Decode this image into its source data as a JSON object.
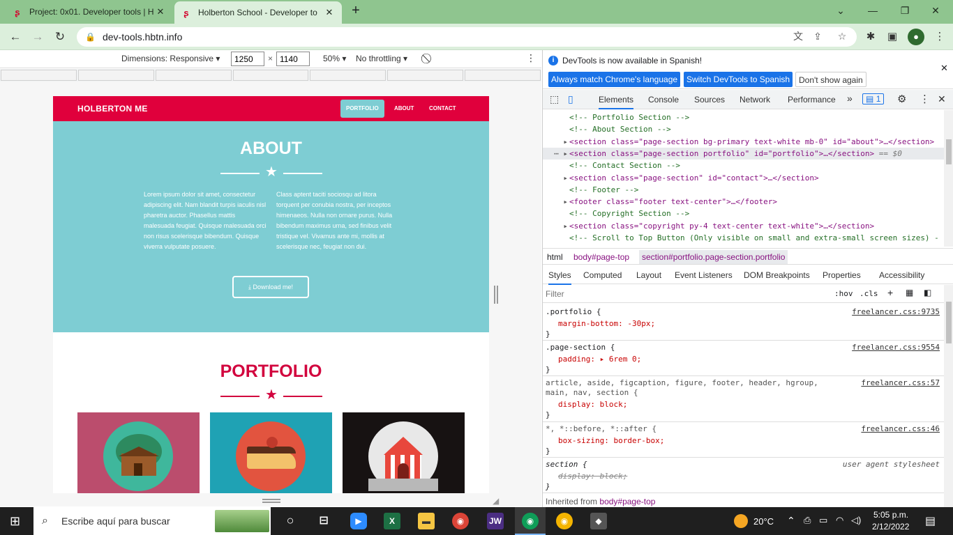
{
  "browser": {
    "tabs": [
      {
        "title": "Project: 0x01. Developer tools | H",
        "active": false
      },
      {
        "title": "Holberton School - Developer to",
        "active": true
      }
    ],
    "url": "dev-tools.hbtn.info"
  },
  "device_toolbar": {
    "dimensions_label": "Dimensions: Responsive",
    "width": "1250",
    "height": "1140",
    "times": "×",
    "zoom": "50%",
    "throttling": "No throttling"
  },
  "site": {
    "brand": "HOLBERTON ME",
    "nav": [
      "PORTFOLIO",
      "ABOUT",
      "CONTACT"
    ],
    "about_title": "ABOUT",
    "about_left": "Lorem ipsum dolor sit amet, consectetur adipiscing elit. Nam blandit turpis iaculis nisl pharetra auctor. Phasellus mattis malesuada feugiat. Quisque malesuada orci non risus scelerisque bibendum. Quisque viverra vulputate posuere.",
    "about_right": "Class aptent taciti sociosqu ad litora torquent per conubia nostra, per inceptos himenaeos. Nulla non ornare purus. Nulla bibendum maximus urna, sed finibus velit tristique vel. Vivamus ante mi, mollis at scelerisque nec, feugiat non dui.",
    "download_label": "Download me!",
    "portfolio_title": "PORTFOLIO",
    "colors": {
      "primary": "#e0003c",
      "about_bg": "#7ecdd3",
      "portfolio": "#d2043e"
    }
  },
  "devtools": {
    "info_message": "DevTools is now available in Spanish!",
    "btn_match": "Always match Chrome's language",
    "btn_switch": "Switch DevTools to Spanish",
    "btn_dont_show": "Don't show again",
    "tabs": [
      "Elements",
      "Console",
      "Sources",
      "Network",
      "Performance"
    ],
    "more": "»",
    "issues_count": "1",
    "dom_lines": [
      {
        "type": "comment",
        "text": "<!-- Portfolio Section -->"
      },
      {
        "type": "comment",
        "text": "<!-- About Section -->"
      },
      {
        "type": "tag",
        "text": "<section class=\"page-section bg-primary text-white mb-0\" id=\"about\">…</section>"
      },
      {
        "type": "tag",
        "text": "<section class=\"page-section portfolio\" id=\"portfolio\">…</section>",
        "selected": true,
        "suffix": "== $0"
      },
      {
        "type": "comment",
        "text": "<!-- Contact Section -->"
      },
      {
        "type": "tag",
        "text": "<section class=\"page-section\" id=\"contact\">…</section>"
      },
      {
        "type": "comment",
        "text": "<!-- Footer -->"
      },
      {
        "type": "tag",
        "text": "<footer class=\"footer text-center\">…</footer>"
      },
      {
        "type": "comment",
        "text": "<!-- Copyright Section -->"
      },
      {
        "type": "tag",
        "text": "<section class=\"copyright py-4 text-center text-white\">…</section>"
      },
      {
        "type": "comment",
        "text": "<!-- Scroll to Top Button (Only visible on small and extra-small screen sizes) -"
      }
    ],
    "breadcrumbs": [
      "html",
      "body#page-top",
      "section#portfolio.page-section.portfolio"
    ],
    "style_tabs": [
      "Styles",
      "Computed",
      "Layout",
      "Event Listeners",
      "DOM Breakpoints",
      "Properties",
      "Accessibility"
    ],
    "filter_placeholder": "Filter",
    "hov": ":hov",
    "cls": ".cls",
    "rules": [
      {
        "selector": ".portfolio {",
        "source": "freelancer.css:9735",
        "props": [
          "margin-bottom: -30px;"
        ]
      },
      {
        "selector": ".page-section {",
        "source": "freelancer.css:9554",
        "props": [
          "padding: ▸ 6rem 0;"
        ]
      },
      {
        "selector": "article, aside, figcaption, figure, footer, header, hgroup, main, nav, section {",
        "source": "freelancer.css:57",
        "props": [
          "display: block;"
        ]
      },
      {
        "selector": "*, *::before, *::after {",
        "source": "freelancer.css:46",
        "props": [
          "box-sizing: border-box;"
        ]
      },
      {
        "selector": "section {",
        "source": "user agent stylesheet",
        "props": [
          "display: block;"
        ]
      }
    ],
    "inherited_from": "Inherited from",
    "inherited_target": "body#page-top"
  },
  "taskbar": {
    "search_placeholder": "Escribe aquí para buscar",
    "weather": "20°C",
    "time": "5:05 p.m.",
    "date": "2/12/2022"
  }
}
